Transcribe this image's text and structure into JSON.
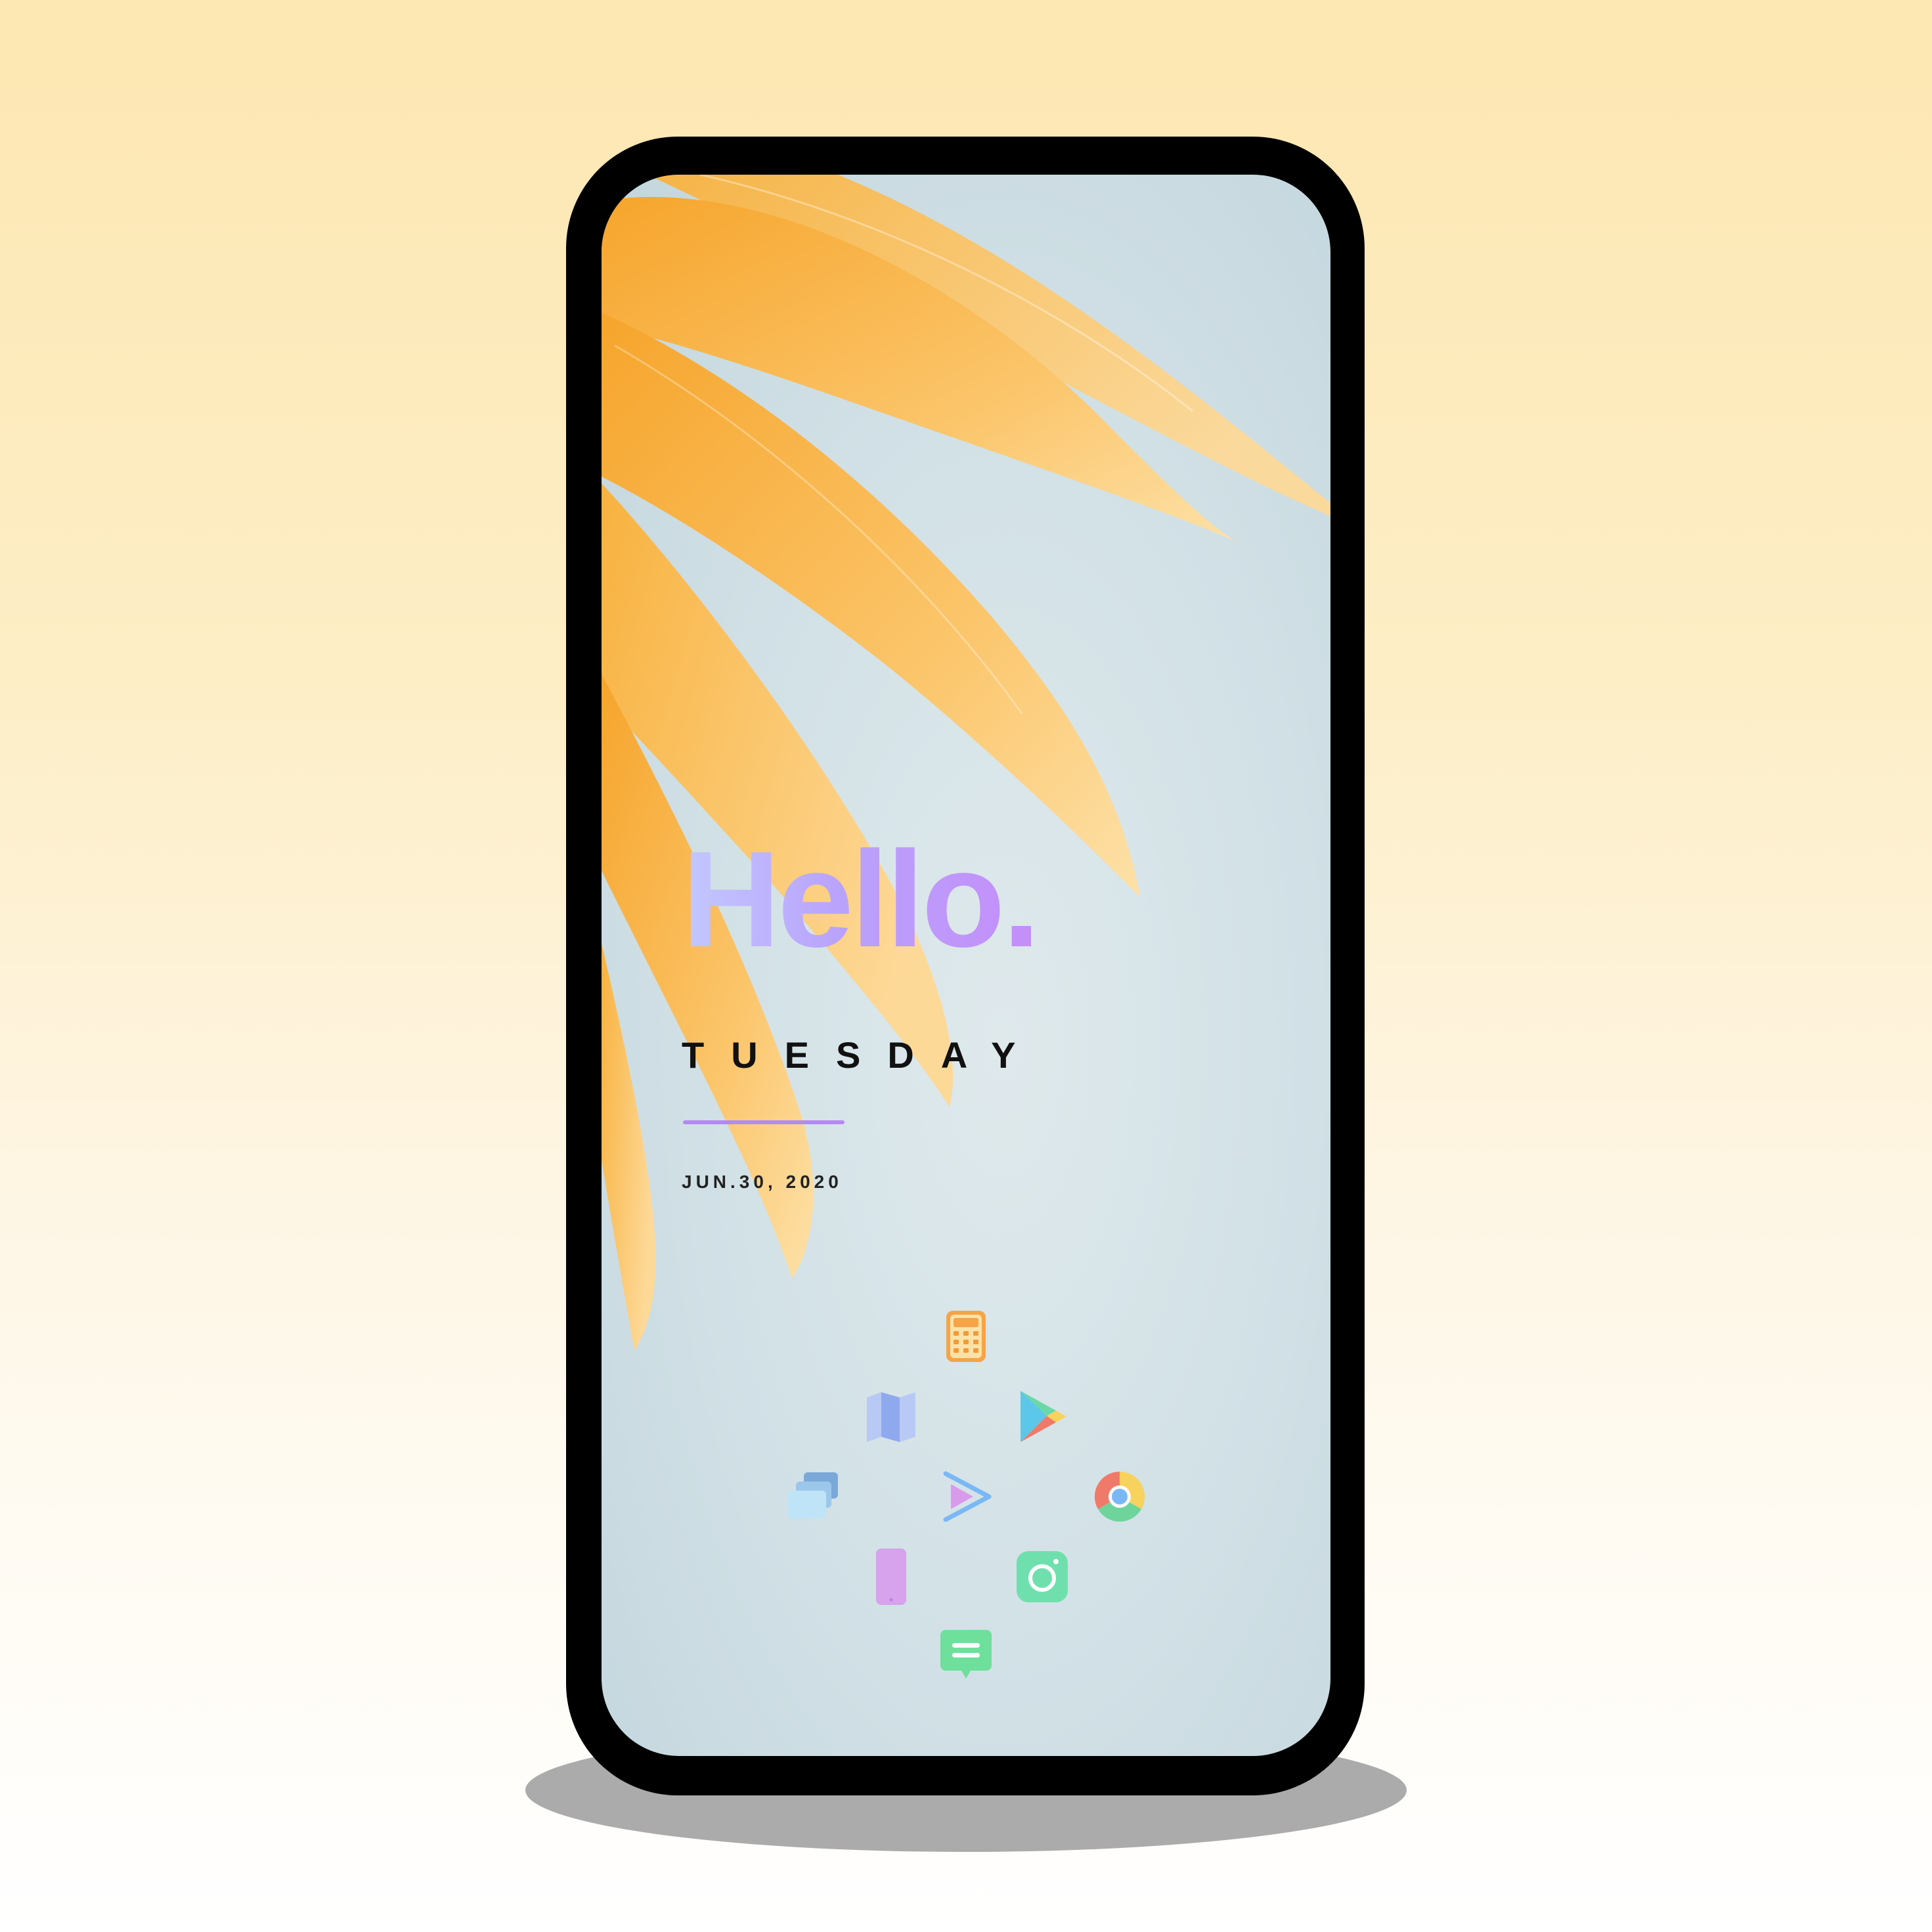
{
  "lockscreen": {
    "greeting": "Hello.",
    "day": "TUESDAY",
    "date": "JUN.30, 2020"
  },
  "apps": [
    {
      "icon": "calculator-icon",
      "color": "#f6a447"
    },
    {
      "icon": "maps-icon",
      "color": "#9db7f2"
    },
    {
      "icon": "play-store-icon",
      "color": "#5cc7e8"
    },
    {
      "icon": "files-icon",
      "color": "#7aa8d8"
    },
    {
      "icon": "play-icon",
      "color": "#b89af0"
    },
    {
      "icon": "chrome-icon",
      "color": "#f07a6a"
    },
    {
      "icon": "phone-icon",
      "color": "#d6a3ec"
    },
    {
      "icon": "camera-icon",
      "color": "#6fe0ad"
    },
    {
      "icon": "messages-icon",
      "color": "#6fdf9c"
    }
  ],
  "colors": {
    "device_frame": "#000000",
    "greeting_gradient_start": "#c3c8ff",
    "greeting_gradient_end": "#c48ef9",
    "accent_rule": "#b38af2",
    "petal": "#f9b545"
  }
}
